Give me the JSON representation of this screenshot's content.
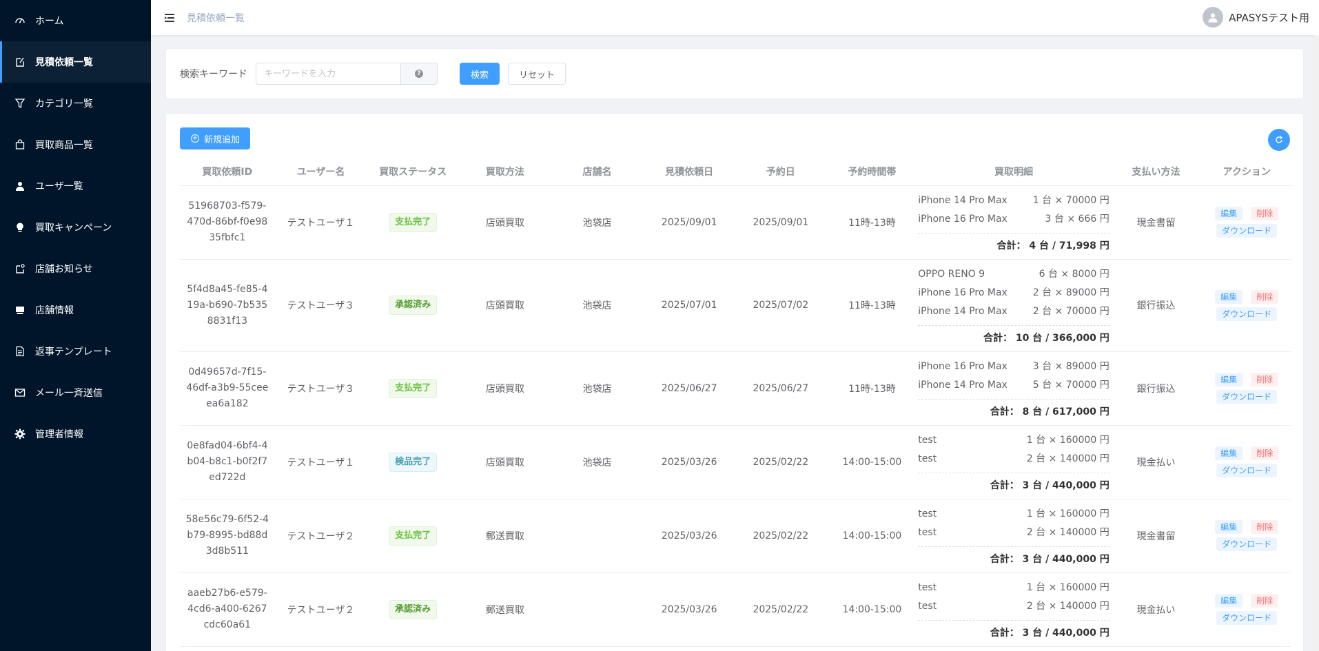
{
  "sidebar": {
    "items": [
      {
        "label": "ホーム",
        "icon": "dashboard-icon"
      },
      {
        "label": "見積依頼一覧",
        "icon": "document-icon",
        "active": true
      },
      {
        "label": "カテゴリ一覧",
        "icon": "filter-icon"
      },
      {
        "label": "買取商品一覧",
        "icon": "bag-icon"
      },
      {
        "label": "ユーザ一覧",
        "icon": "user-icon"
      },
      {
        "label": "買取キャンペーン",
        "icon": "bulb-icon"
      },
      {
        "label": "店舗お知らせ",
        "icon": "notice-icon"
      },
      {
        "label": "店舗情報",
        "icon": "shop-icon"
      },
      {
        "label": "返事テンプレート",
        "icon": "template-icon"
      },
      {
        "label": "メール一斉送信",
        "icon": "mail-icon"
      },
      {
        "label": "管理者情報",
        "icon": "gear-icon"
      }
    ]
  },
  "header": {
    "breadcrumb": "見積依頼一覧",
    "user_name": "APASYSテスト用"
  },
  "search": {
    "label": "検索キーワード",
    "placeholder": "キーワードを入力",
    "value": "",
    "search_button": "検索",
    "reset_button": "リセット"
  },
  "toolbar": {
    "add_button": "新規追加"
  },
  "table": {
    "columns": [
      "買取依頼ID",
      "ユーザー名",
      "買取ステータス",
      "買取方法",
      "店舗名",
      "見積依頼日",
      "予約日",
      "予約時間帯",
      "買取明細",
      "支払い方法",
      "アクション"
    ],
    "action_labels": {
      "edit": "編集",
      "delete": "削除",
      "download": "ダウンロード"
    },
    "total_prefix": "合計：",
    "rows": [
      {
        "id": "51968703-f579-470d-86bf-f0e9835fbfc1",
        "user": "テストユーザ１",
        "status": "支払完了",
        "status_type": "paid",
        "method": "店頭買取",
        "store": "池袋店",
        "request_date": "2025/09/01",
        "reserve_date": "2025/09/01",
        "time_slot": "11時-13時",
        "items": [
          {
            "name": "iPhone 14 Pro Max",
            "qty": "1 台 × 70000 円"
          },
          {
            "name": "iPhone 16 Pro Max",
            "qty": "3 台 × 666 円"
          }
        ],
        "total": "4 台 / 71,998 円",
        "payment": "現金書留"
      },
      {
        "id": "5f4d8a45-fe85-419a-b690-7b5358831f13",
        "user": "テストユーザ３",
        "status": "承認済み",
        "status_type": "approved",
        "method": "店頭買取",
        "store": "池袋店",
        "request_date": "2025/07/01",
        "reserve_date": "2025/07/02",
        "time_slot": "11時-13時",
        "items": [
          {
            "name": "OPPO RENO 9",
            "qty": "6 台 × 8000 円"
          },
          {
            "name": "iPhone 16 Pro Max",
            "qty": "2 台 × 89000 円"
          },
          {
            "name": "iPhone 14 Pro Max",
            "qty": "2 台 × 70000 円"
          }
        ],
        "total": "10 台 / 366,000 円",
        "payment": "銀行振込"
      },
      {
        "id": "0d49657d-7f15-46df-a3b9-55ceeea6a182",
        "user": "テストユーザ３",
        "status": "支払完了",
        "status_type": "paid",
        "method": "店頭買取",
        "store": "池袋店",
        "request_date": "2025/06/27",
        "reserve_date": "2025/06/27",
        "time_slot": "11時-13時",
        "items": [
          {
            "name": "iPhone 16 Pro Max",
            "qty": "3 台 × 89000 円"
          },
          {
            "name": "iPhone 14 Pro Max",
            "qty": "5 台 × 70000 円"
          }
        ],
        "total": "8 台 / 617,000 円",
        "payment": "銀行振込"
      },
      {
        "id": "0e8fad04-6bf4-4b04-b8c1-b0f2f7ed722d",
        "user": "テストユーザ１",
        "status": "検品完了",
        "status_type": "inspected",
        "method": "店頭買取",
        "store": "池袋店",
        "request_date": "2025/03/26",
        "reserve_date": "2025/02/22",
        "time_slot": "14:00-15:00",
        "items": [
          {
            "name": "test",
            "qty": "1 台 × 160000 円"
          },
          {
            "name": "test",
            "qty": "2 台 × 140000 円"
          }
        ],
        "total": "3 台 / 440,000 円",
        "payment": "現金払い"
      },
      {
        "id": "58e56c79-6f52-4b79-8995-bd88d3d8b511",
        "user": "テストユーザ２",
        "status": "支払完了",
        "status_type": "paid",
        "method": "郵送買取",
        "store": "",
        "request_date": "2025/03/26",
        "reserve_date": "2025/02/22",
        "time_slot": "14:00-15:00",
        "items": [
          {
            "name": "test",
            "qty": "1 台 × 160000 円"
          },
          {
            "name": "test",
            "qty": "2 台 × 140000 円"
          }
        ],
        "total": "3 台 / 440,000 円",
        "payment": "現金書留"
      },
      {
        "id": "aaeb27b6-e579-4cd6-a400-6267cdc60a61",
        "user": "テストユーザ２",
        "status": "承認済み",
        "status_type": "approved",
        "method": "郵送買取",
        "store": "",
        "request_date": "2025/03/26",
        "reserve_date": "2025/02/22",
        "time_slot": "14:00-15:00",
        "items": [
          {
            "name": "test",
            "qty": "1 台 × 160000 円"
          },
          {
            "name": "test",
            "qty": "2 台 × 140000 円"
          }
        ],
        "total": "3 台 / 440,000 円",
        "payment": "現金払い"
      }
    ]
  },
  "colors": {
    "sidebar_bg": "#001529",
    "primary": "#409eff",
    "danger": "#f56c6c",
    "success": "#67c23a"
  }
}
